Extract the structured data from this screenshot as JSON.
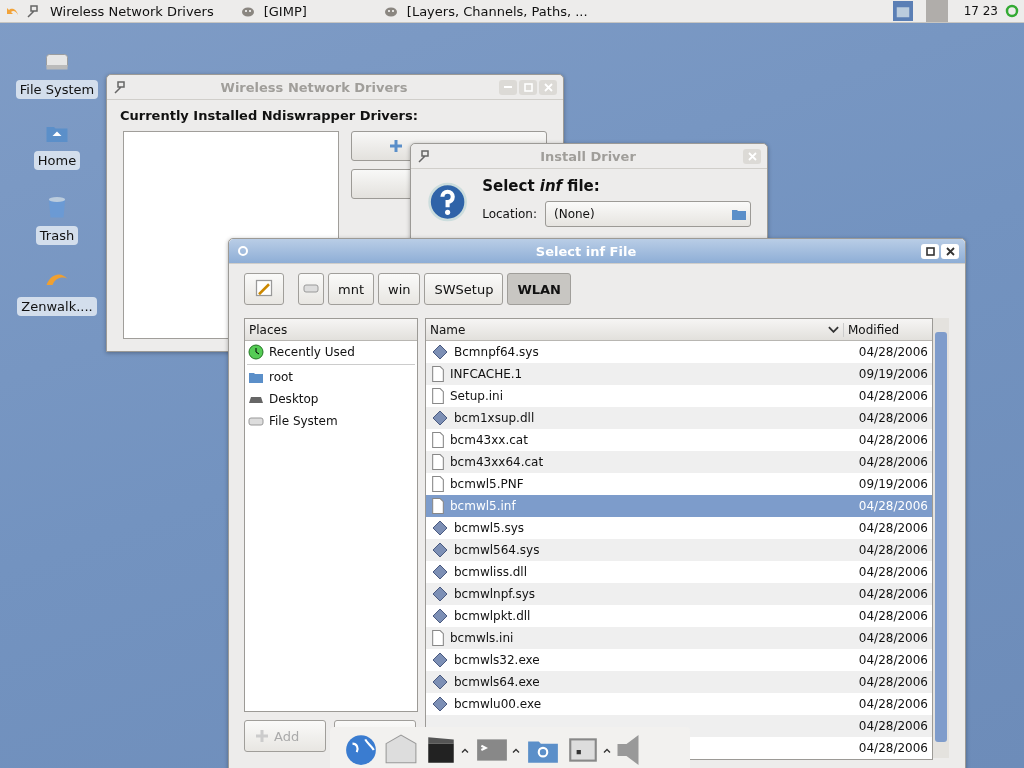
{
  "top_panel": {
    "tasks": [
      {
        "label": "Wireless Network Drivers"
      },
      {
        "label": "[GIMP]"
      },
      {
        "label": "[Layers, Channels, Paths, ..."
      }
    ],
    "clock": "17 23"
  },
  "desktop_icons": [
    {
      "label": "File System",
      "kind": "drive"
    },
    {
      "label": "Home",
      "kind": "home"
    },
    {
      "label": "Trash",
      "kind": "trash"
    },
    {
      "label": "Zenwalk....",
      "kind": "dolphin"
    }
  ],
  "drivers_window": {
    "title": "Wireless Network Drivers",
    "heading": "Currently Installed Ndiswrapper Drivers:"
  },
  "install_window": {
    "title": "Install Driver",
    "prompt": "Select *inf* file:",
    "location_label": "Location:",
    "location_value": "(None)"
  },
  "file_dialog": {
    "title": "Select inf File",
    "path_buttons": [
      {
        "label": "mnt",
        "selected": false
      },
      {
        "label": "win",
        "selected": false
      },
      {
        "label": "SWSetup",
        "selected": false
      },
      {
        "label": "WLAN",
        "selected": true
      }
    ],
    "places_header": "Places",
    "places": [
      {
        "label": "Recently Used",
        "kind": "recent"
      },
      {
        "label": "root",
        "kind": "home"
      },
      {
        "label": "Desktop",
        "kind": "desktop"
      },
      {
        "label": "File System",
        "kind": "drive"
      }
    ],
    "columns": [
      "Name",
      "Modified"
    ],
    "rows": [
      {
        "name": "Bcmnpf64.sys",
        "modified": "04/28/2006",
        "kind": "binary",
        "selected": false
      },
      {
        "name": "INFCACHE.1",
        "modified": "09/19/2006",
        "kind": "text",
        "selected": false
      },
      {
        "name": "Setup.ini",
        "modified": "04/28/2006",
        "kind": "text",
        "selected": false
      },
      {
        "name": "bcm1xsup.dll",
        "modified": "04/28/2006",
        "kind": "binary",
        "selected": false
      },
      {
        "name": "bcm43xx.cat",
        "modified": "04/28/2006",
        "kind": "text",
        "selected": false
      },
      {
        "name": "bcm43xx64.cat",
        "modified": "04/28/2006",
        "kind": "text",
        "selected": false
      },
      {
        "name": "bcmwl5.PNF",
        "modified": "09/19/2006",
        "kind": "text",
        "selected": false
      },
      {
        "name": "bcmwl5.inf",
        "modified": "04/28/2006",
        "kind": "text",
        "selected": true
      },
      {
        "name": "bcmwl5.sys",
        "modified": "04/28/2006",
        "kind": "binary",
        "selected": false
      },
      {
        "name": "bcmwl564.sys",
        "modified": "04/28/2006",
        "kind": "binary",
        "selected": false
      },
      {
        "name": "bcmwliss.dll",
        "modified": "04/28/2006",
        "kind": "binary",
        "selected": false
      },
      {
        "name": "bcmwlnpf.sys",
        "modified": "04/28/2006",
        "kind": "binary",
        "selected": false
      },
      {
        "name": "bcmwlpkt.dll",
        "modified": "04/28/2006",
        "kind": "binary",
        "selected": false
      },
      {
        "name": "bcmwls.ini",
        "modified": "04/28/2006",
        "kind": "text",
        "selected": false
      },
      {
        "name": "bcmwls32.exe",
        "modified": "04/28/2006",
        "kind": "binary",
        "selected": false
      },
      {
        "name": "bcmwls64.exe",
        "modified": "04/28/2006",
        "kind": "binary",
        "selected": false
      },
      {
        "name": "bcmwlu00.exe",
        "modified": "04/28/2006",
        "kind": "binary",
        "selected": false
      },
      {
        "modified": "04/28/2006",
        "selected": false
      },
      {
        "modified": "04/28/2006",
        "selected": false
      }
    ],
    "add_button": "Add"
  },
  "dock": {
    "items": [
      {
        "kind": "globe"
      },
      {
        "kind": "mail"
      },
      {
        "kind": "clapper"
      },
      {
        "kind": "terminal"
      },
      {
        "kind": "folder-search"
      },
      {
        "kind": "monitor"
      },
      {
        "kind": "speaker"
      }
    ]
  }
}
